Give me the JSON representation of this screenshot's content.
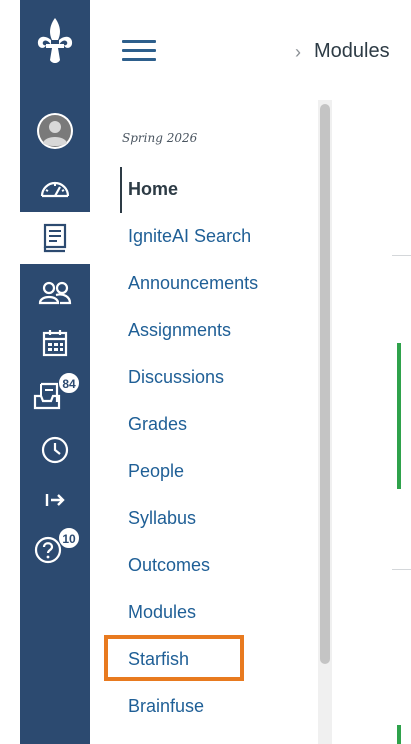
{
  "header": {
    "menu_icon": "hamburger-icon",
    "breadcrumb_separator": "›",
    "breadcrumb_current": "Modules"
  },
  "global_nav": {
    "items": [
      {
        "icon": "fleur-de-lis-logo"
      },
      {
        "icon": "user-avatar-icon"
      },
      {
        "icon": "dashboard-gauge-icon"
      },
      {
        "icon": "courses-book-icon",
        "active": true
      },
      {
        "icon": "groups-icon"
      },
      {
        "icon": "calendar-icon"
      },
      {
        "icon": "inbox-icon",
        "badge": "84"
      },
      {
        "icon": "history-clock-icon"
      },
      {
        "icon": "logout-arrow-icon"
      },
      {
        "icon": "help-icon",
        "badge": "10"
      }
    ]
  },
  "course_nav": {
    "term": "Spring 2026",
    "links": [
      "Home",
      "IgniteAI Search",
      "Announcements",
      "Assignments",
      "Discussions",
      "Grades",
      "People",
      "Syllabus",
      "Outcomes",
      "Modules",
      "Starfish",
      "Brainfuse"
    ],
    "active_link": "Home",
    "highlighted_link": "Starfish"
  },
  "colors": {
    "rail": "#2c4a70",
    "link": "#1f5f96",
    "highlight": "#e87a1f",
    "status_green": "#2fa24b"
  }
}
